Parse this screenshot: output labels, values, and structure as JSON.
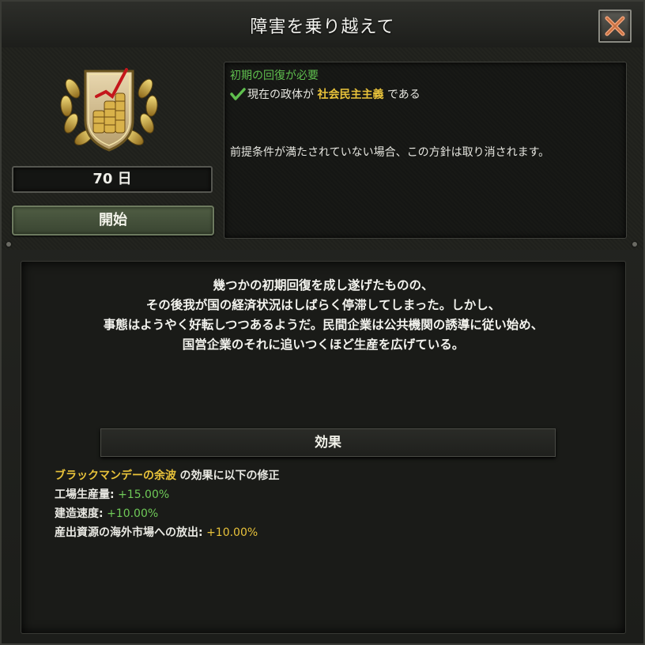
{
  "window": {
    "title": "障害を乗り越えて",
    "close_icon": "close-x-icon"
  },
  "focus": {
    "emblem_icon": "economic-recovery-laurel-emblem",
    "days": "70 日",
    "start_label": "開始"
  },
  "requirements": {
    "title": "初期の回復が必要",
    "check_icon": "checkmark-icon",
    "line_prefix": "現在の政体が",
    "line_value": "社会民主主義",
    "line_suffix": "である",
    "note": "前提条件が満たされていない場合、この方針は取り消されます。"
  },
  "description": {
    "lines": [
      "幾つかの初期回復を成し遂げたものの、",
      "その後我が国の経済状況はしばらく停滞してしまった。しかし、",
      "事態はようやく好転しつつあるようだ。民間企業は公共機関の誘導に従い始め、",
      "国営企業のそれに追いつくほど生産を広げている。"
    ]
  },
  "effects": {
    "header": "効果",
    "modifier_name": "ブラックマンデーの余波",
    "modifier_suffix": "の効果に以下の修正",
    "items": [
      {
        "label": "工場生産量:",
        "value": "+15.00%"
      },
      {
        "label": "建造速度:",
        "value": "+10.00%"
      },
      {
        "label": "産出資源の海外市場への放出:",
        "value": "+10.00%"
      }
    ]
  },
  "colors": {
    "requirement_green": "#5fbf4e",
    "highlight_gold": "#e8c23a",
    "bonus_green": "#6fca58",
    "start_button": "#4f5d43"
  }
}
